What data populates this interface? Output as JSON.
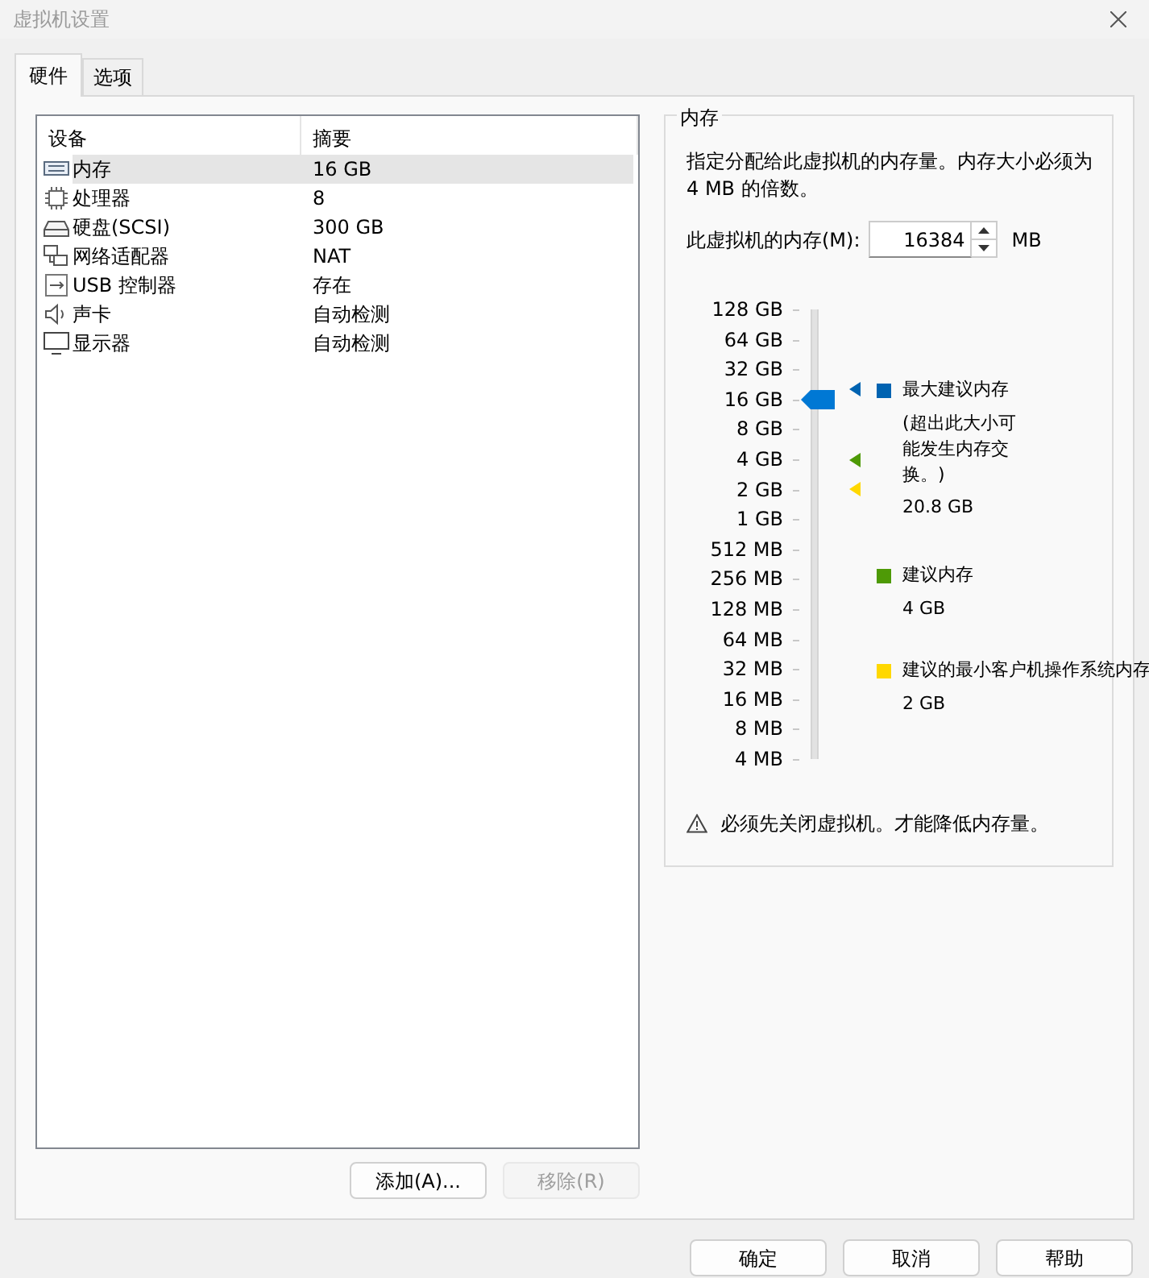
{
  "window": {
    "title": "虚拟机设置"
  },
  "tabs": [
    {
      "label": "硬件",
      "selected": true
    },
    {
      "label": "选项",
      "selected": false
    }
  ],
  "devices": {
    "columns": [
      "设备",
      "摘要"
    ],
    "rows": [
      {
        "kind": "memory",
        "name": "内存",
        "summary": "16 GB",
        "selected": true
      },
      {
        "kind": "cpu",
        "name": "处理器",
        "summary": "8",
        "selected": false
      },
      {
        "kind": "disk",
        "name": "硬盘(SCSI)",
        "summary": "300 GB",
        "selected": false
      },
      {
        "kind": "network",
        "name": "网络适配器",
        "summary": "NAT",
        "selected": false
      },
      {
        "kind": "usb",
        "name": "USB 控制器",
        "summary": "存在",
        "selected": false
      },
      {
        "kind": "sound",
        "name": "声卡",
        "summary": "自动检测",
        "selected": false
      },
      {
        "kind": "display",
        "name": "显示器",
        "summary": "自动检测",
        "selected": false
      }
    ]
  },
  "device_buttons": [
    {
      "label": "添加(A)...",
      "disabled": false
    },
    {
      "label": "移除(R)",
      "disabled": true
    }
  ],
  "memory": {
    "title": "内存",
    "description": "指定分配给此虚拟机的内存量。内存大小必须为 4 MB 的倍数。",
    "field_label": "此虚拟机的内存(M):",
    "value": "16384",
    "unit": "MB",
    "scale": [
      "128 GB",
      "64 GB",
      "32 GB",
      "16 GB",
      "8 GB",
      "4 GB",
      "2 GB",
      "1 GB",
      "512 MB",
      "256 MB",
      "128 MB",
      "64 MB",
      "32 MB",
      "16 MB",
      "8 MB",
      "4 MB"
    ],
    "slider": {
      "level": 0.8
    },
    "markers": [
      {
        "color": "#0063b1",
        "level": 0.825
      },
      {
        "color": "#4e9a06",
        "level": 0.667
      },
      {
        "color": "#ffd800",
        "level": 0.6
      }
    ],
    "legend": [
      {
        "color": "#0063b1",
        "label": "最大建议内存",
        "note": "(超出此大小可能发生内存交换。)",
        "value": "20.8 GB"
      },
      {
        "color": "#4e9a06",
        "label": "建议内存",
        "value": "4 GB"
      },
      {
        "color": "#ffd800",
        "label": "建议的最小客户机操作系统内存",
        "value": "2 GB"
      }
    ],
    "warning": "必须先关闭虚拟机。才能降低内存量。"
  },
  "buttons": [
    "确定",
    "取消",
    "帮助"
  ]
}
